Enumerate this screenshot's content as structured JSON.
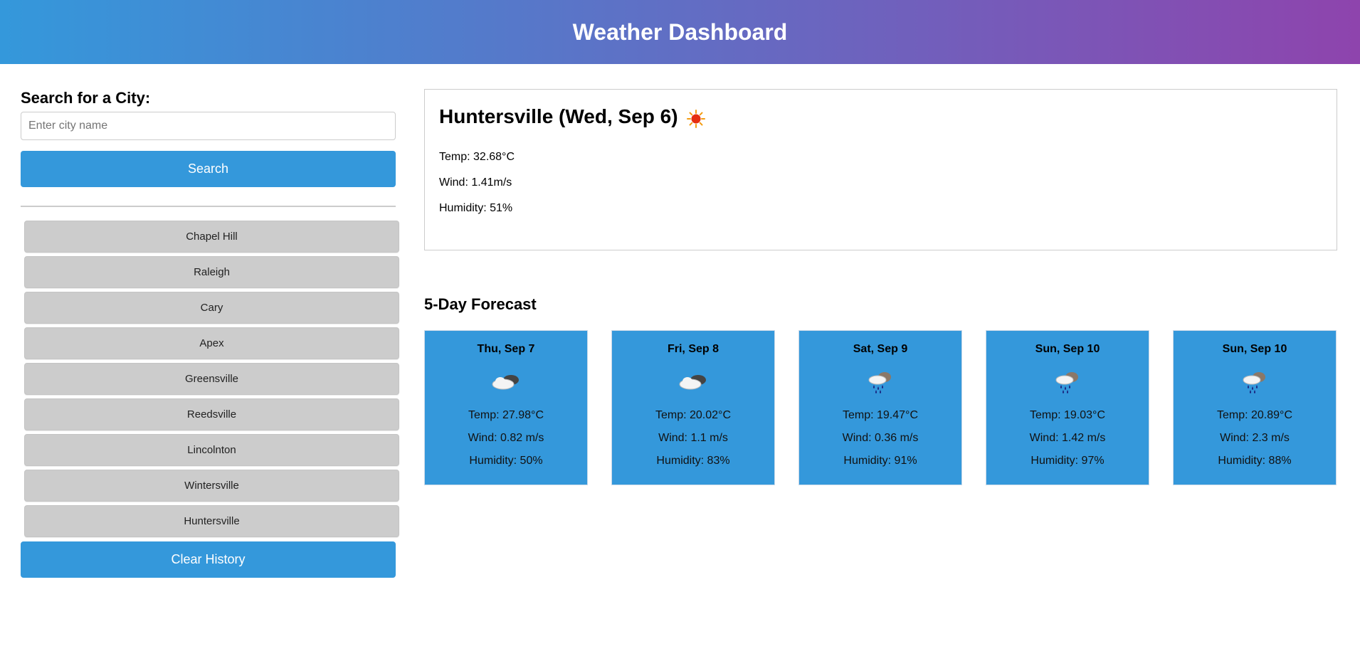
{
  "header": {
    "title": "Weather Dashboard"
  },
  "search": {
    "label": "Search for a City:",
    "placeholder": "Enter city name",
    "value": "",
    "button_label": "Search"
  },
  "history": {
    "cities": [
      "Chapel Hill",
      "Raleigh",
      "Cary",
      "Apex",
      "Greensville",
      "Reedsville",
      "Lincolnton",
      "Wintersville",
      "Huntersville"
    ],
    "clear_label": "Clear History"
  },
  "current": {
    "title": "Huntersville (Wed, Sep 6)",
    "icon": "sun-icon",
    "temp": "Temp: 32.68°C",
    "wind": "Wind: 1.41m/s",
    "humidity": "Humidity: 51%"
  },
  "forecast": {
    "title": "5-Day Forecast",
    "days": [
      {
        "date": "Thu, Sep 7",
        "icon": "cloudy-icon",
        "temp": "Temp: 27.98°C",
        "wind": "Wind: 0.82 m/s",
        "humidity": "Humidity: 50%"
      },
      {
        "date": "Fri, Sep 8",
        "icon": "cloudy-icon",
        "temp": "Temp: 20.02°C",
        "wind": "Wind: 1.1 m/s",
        "humidity": "Humidity: 83%"
      },
      {
        "date": "Sat, Sep 9",
        "icon": "rain-icon",
        "temp": "Temp: 19.47°C",
        "wind": "Wind: 0.36 m/s",
        "humidity": "Humidity: 91%"
      },
      {
        "date": "Sun, Sep 10",
        "icon": "rain-icon",
        "temp": "Temp: 19.03°C",
        "wind": "Wind: 1.42 m/s",
        "humidity": "Humidity: 97%"
      },
      {
        "date": "Sun, Sep 10",
        "icon": "rain-icon",
        "temp": "Temp: 20.89°C",
        "wind": "Wind: 2.3 m/s",
        "humidity": "Humidity: 88%"
      }
    ]
  },
  "colors": {
    "header_gradient_start": "#3498db",
    "header_gradient_end": "#8e44ad",
    "accent": "#3498db",
    "history_button": "#cccccc"
  }
}
